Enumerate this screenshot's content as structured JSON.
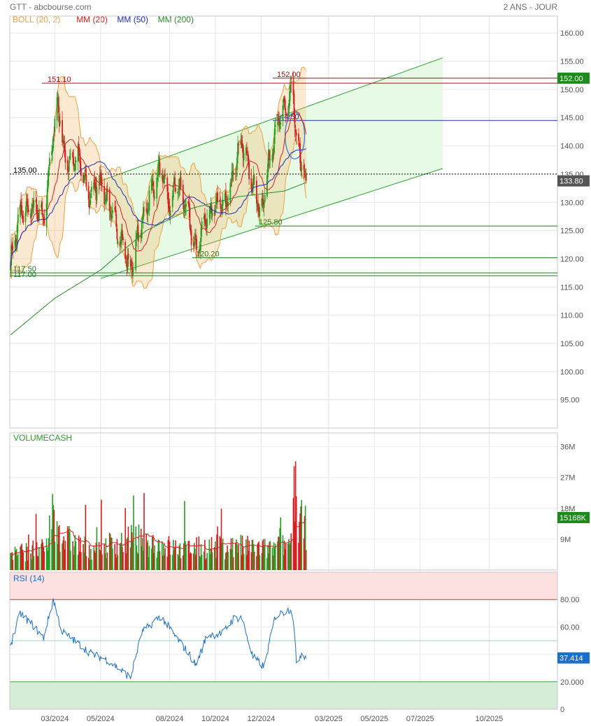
{
  "header": {
    "title": "GTT - abcbourse.com",
    "range": "2 ANS - JOUR"
  },
  "legend": [
    {
      "label": "BOLL (20, 2)",
      "color": "#f0a040"
    },
    {
      "label": "MM (20)",
      "color": "#d62020"
    },
    {
      "label": "MM (50)",
      "color": "#1c2fb5"
    },
    {
      "label": "MM (200)",
      "color": "#2a8a2a"
    }
  ],
  "colors": {
    "up": "#22a022",
    "down": "#d62020",
    "boll": "#f0a040",
    "channel": "#2ea02e",
    "rsi": "#1c6fc9"
  },
  "price_axis": {
    "ticks": [
      "160.00",
      "155.00",
      "150.00",
      "145.00",
      "140.00",
      "135.00",
      "130.00",
      "125.00",
      "120.00",
      "115.00",
      "110.00",
      "105.00",
      "100.00",
      "95.00"
    ]
  },
  "levels": [
    {
      "label": "151.10",
      "value": 151.1,
      "color": "#a01010"
    },
    {
      "label": "152.00",
      "value": 152.0,
      "color": "#a01010"
    },
    {
      "label": "144.50",
      "value": 144.5,
      "color": "#1c2fb5"
    },
    {
      "label": "135.00",
      "value": 135.0,
      "color": "#000000"
    },
    {
      "label": "125.80",
      "value": 125.8,
      "color": "#1e7a1e"
    },
    {
      "label": "120.20",
      "value": 120.2,
      "color": "#1e7a1e"
    },
    {
      "label": "117.50",
      "value": 117.5,
      "color": "#1e7a1e"
    },
    {
      "label": "117.00",
      "value": 117.0,
      "color": "#1e7a1e"
    }
  ],
  "price_badges": {
    "high": "152.00",
    "last": "133.80"
  },
  "volume": {
    "title": "VOLUMECASH",
    "ticks": [
      "36M",
      "27M",
      "18M",
      "9M"
    ],
    "last": "15168K"
  },
  "rsi": {
    "title": "RSI (14)",
    "ticks": [
      "80.00",
      "60.00",
      "20.000",
      "0"
    ],
    "last": "37.414"
  },
  "x_axis": {
    "labels": [
      "03/2024",
      "05/2024",
      "08/2024",
      "10/2024",
      "12/2024",
      "03/2025",
      "05/2025",
      "07/2025",
      "10/2025"
    ]
  },
  "chart_data": {
    "type": "candlestick",
    "series": [
      {
        "name": "MM (20)"
      },
      {
        "name": "MM (50)"
      },
      {
        "name": "MM (200)"
      },
      {
        "name": "BOLL (20, 2)"
      }
    ],
    "close_anchors": [
      [
        "2024-01-02",
        119.5
      ],
      [
        "2024-01-15",
        128.0
      ],
      [
        "2024-02-01",
        129.0
      ],
      [
        "2024-02-15",
        127.0
      ],
      [
        "2024-02-27",
        141.0
      ],
      [
        "2024-03-05",
        148.0
      ],
      [
        "2024-03-15",
        137.0
      ],
      [
        "2024-04-01",
        138.0
      ],
      [
        "2024-04-15",
        131.0
      ],
      [
        "2024-05-01",
        134.0
      ],
      [
        "2024-05-15",
        128.0
      ],
      [
        "2024-05-28",
        124.0
      ],
      [
        "2024-06-10",
        117.5
      ],
      [
        "2024-06-20",
        124.0
      ],
      [
        "2024-07-05",
        131.0
      ],
      [
        "2024-07-20",
        136.0
      ],
      [
        "2024-08-01",
        129.0
      ],
      [
        "2024-08-10",
        134.0
      ],
      [
        "2024-08-25",
        128.0
      ],
      [
        "2024-09-05",
        121.0
      ],
      [
        "2024-09-15",
        126.0
      ],
      [
        "2024-10-01",
        130.0
      ],
      [
        "2024-10-15",
        129.0
      ],
      [
        "2024-10-25",
        136.0
      ],
      [
        "2024-11-05",
        141.0
      ],
      [
        "2024-11-20",
        133.0
      ],
      [
        "2024-12-01",
        128.0
      ],
      [
        "2024-12-10",
        136.0
      ],
      [
        "2024-12-20",
        143.0
      ],
      [
        "2025-01-05",
        147.0
      ],
      [
        "2025-01-12",
        151.0
      ],
      [
        "2025-01-17",
        140.0
      ],
      [
        "2025-01-25",
        136.0
      ],
      [
        "2025-01-30",
        133.8
      ]
    ],
    "ma200_anchors": [
      [
        "2024-01-02",
        106.5
      ],
      [
        "2024-03-01",
        113.0
      ],
      [
        "2024-05-01",
        118.0
      ],
      [
        "2024-07-01",
        125.0
      ],
      [
        "2024-09-01",
        129.0
      ],
      [
        "2024-11-01",
        131.0
      ],
      [
        "2025-01-01",
        132.0
      ],
      [
        "2025-01-30",
        133.5
      ]
    ],
    "channel": {
      "lower": [
        [
          "2024-05-01",
          116.5
        ],
        [
          "2025-07-31",
          136.0
        ]
      ],
      "upper": [
        [
          "2024-05-01",
          133.8
        ],
        [
          "2025-07-31",
          155.6
        ]
      ]
    },
    "ellipse": {
      "center_date": "2025-01-15",
      "center_price": 141.8,
      "w_days": 13,
      "h_price": 8.2
    },
    "volume_anchors": [
      [
        "2024-01-02",
        5
      ],
      [
        "2024-02-20",
        6
      ],
      [
        "2024-02-25",
        18
      ],
      [
        "2024-03-01",
        14
      ],
      [
        "2024-03-15",
        9
      ],
      [
        "2024-04-15",
        6
      ],
      [
        "2024-06-15",
        9
      ],
      [
        "2024-08-15",
        6
      ],
      [
        "2024-10-15",
        7
      ],
      [
        "2024-12-15",
        6
      ],
      [
        "2025-01-10",
        8
      ],
      [
        "2025-01-14",
        27
      ],
      [
        "2025-01-20",
        14
      ],
      [
        "2025-01-30",
        12
      ]
    ],
    "rsi_anchors": [
      [
        "2024-01-02",
        47
      ],
      [
        "2024-01-15",
        70
      ],
      [
        "2024-02-01",
        61
      ],
      [
        "2024-02-15",
        52
      ],
      [
        "2024-02-28",
        80
      ],
      [
        "2024-03-10",
        57
      ],
      [
        "2024-04-01",
        48
      ],
      [
        "2024-04-20",
        40
      ],
      [
        "2024-05-10",
        36
      ],
      [
        "2024-06-10",
        23
      ],
      [
        "2024-06-25",
        56
      ],
      [
        "2024-07-20",
        68
      ],
      [
        "2024-08-10",
        52
      ],
      [
        "2024-08-25",
        42
      ],
      [
        "2024-09-05",
        32
      ],
      [
        "2024-09-20",
        54
      ],
      [
        "2024-10-10",
        55
      ],
      [
        "2024-10-25",
        66
      ],
      [
        "2024-11-05",
        67
      ],
      [
        "2024-11-20",
        38
      ],
      [
        "2024-12-05",
        31
      ],
      [
        "2024-12-20",
        68
      ],
      [
        "2025-01-05",
        72
      ],
      [
        "2025-01-12",
        74
      ],
      [
        "2025-01-17",
        34
      ],
      [
        "2025-01-25",
        42
      ],
      [
        "2025-01-30",
        37.414
      ]
    ],
    "x_range": [
      "2024-01-01",
      "2025-12-31"
    ],
    "y_range_price": [
      90,
      163
    ],
    "y_range_volume": [
      0,
      40
    ],
    "y_range_rsi": [
      0,
      100
    ],
    "rsi_bands": [
      20,
      80
    ],
    "grid": true
  }
}
